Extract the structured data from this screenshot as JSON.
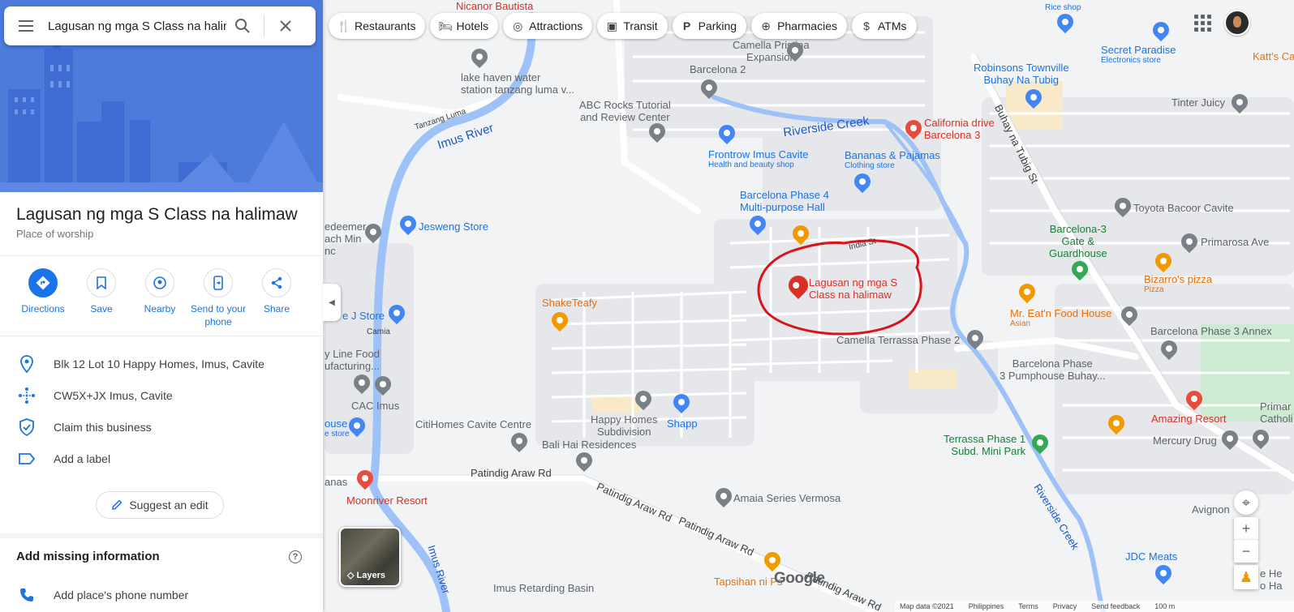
{
  "search": {
    "value": "Lagusan ng mga S Class na halimaw"
  },
  "place": {
    "title": "Lagusan ng mga S Class na halimaw",
    "category": "Place of worship"
  },
  "actions": [
    {
      "label": "Directions"
    },
    {
      "label": "Save"
    },
    {
      "label": "Nearby"
    },
    {
      "label": "Send to your phone"
    },
    {
      "label": "Share"
    }
  ],
  "info": {
    "address": "Blk 12 Lot 10 Happy Homes, Imus, Cavite",
    "plus_code": "CW5X+JX Imus, Cavite",
    "claim": "Claim this business",
    "label": "Add a label"
  },
  "suggest_edit": "Suggest an edit",
  "missing": {
    "title": "Add missing information",
    "phone": "Add place's phone number"
  },
  "chips": [
    {
      "label": "Restaurants",
      "icon": "fork-knife-icon"
    },
    {
      "label": "Hotels",
      "icon": "bed-icon"
    },
    {
      "label": "Attractions",
      "icon": "camera-icon"
    },
    {
      "label": "Transit",
      "icon": "bus-icon"
    },
    {
      "label": "Parking",
      "icon": "parking-icon"
    },
    {
      "label": "Pharmacies",
      "icon": "pharmacy-icon"
    },
    {
      "label": "ATMs",
      "icon": "atm-icon"
    }
  ],
  "map_labels": {
    "nicanor": "Nicanor Bautista",
    "rice_shop": "Rice shop",
    "lake_haven": "lake haven water",
    "lake_haven2": "station tanzang luma v...",
    "camella_pristina": "Camella Pristina",
    "expansion": "Expansion",
    "barcelona2": "Barcelona 2",
    "abc_rocks": "ABC Rocks Tutorial",
    "abc_rocks2": "and Review Center",
    "robinsons": "Robinsons Townville",
    "buhay": "Buhay Na Tubig",
    "secret_paradise": "Secret Paradise",
    "electronics": "Electronics store",
    "katts": "Katt's Ca",
    "tinter": "Tinter Juicy",
    "tanzang_luma": "Tanzang Luma",
    "imus_river": "Imus River",
    "riverside_creek": "Riverside Creek",
    "california": "California drive",
    "california2": "Barcelona 3",
    "frontrow": "Frontrow Imus Cavite",
    "frontrow_sub": "Health and beauty shop",
    "bananas": "Bananas & Pajamas",
    "bananas_sub": "Clothing store",
    "buhay_st": "Buhay na Tubig St",
    "barcelona4": "Barcelona Phase 4",
    "barcelona4b": "Multi-purpose Hall",
    "toyota": "Toyota Bacoor Cavite",
    "redeemer": "edeemer",
    "redeemer2": "ach Min",
    "redeemer3": "nc",
    "jesweng": "Jesweng Store",
    "india": "India St",
    "pin_label": "Lagusan ng mga S",
    "pin_label2": "Class na halimaw",
    "barcelona3gate": "Barcelona-3",
    "barcelona3gate2": "Gate &",
    "barcelona3gate3": "Guardhouse",
    "primarosa": "Primarosa Ave",
    "bizarros": "Bizarro's pizza",
    "bizarros_sub": "Pizza",
    "jstore": "e J Store",
    "camia": "Camia",
    "shaketeafy": "ShakeTeafy",
    "mreatn": "Mr. Eat'n Food House",
    "mreatn_sub": "Asian",
    "barcelona3annex": "Barcelona Phase 3 Annex",
    "camella_terrassa": "Camella Terrassa Phase 2",
    "lineFood": "y Line Food",
    "lineFood2": "ufacturing...",
    "barcelona_pump": "Barcelona Phase",
    "barcelona_pump2": "3 Pumphouse Buhay...",
    "cac": "CAC Imus",
    "happy_homes": "Happy Homes",
    "happy_homes2": "Subdivision",
    "shapp": "Shapp",
    "amazing": "Amazing Resort",
    "primar": "Primar",
    "catholi": "Catholi",
    "house": "ouse",
    "house_sub": "e store",
    "citihomes": "CitiHomes Cavite Centre",
    "bali_hai": "Bali Hai Residences",
    "terrassa1": "Terrassa Phase 1",
    "terrassa1b": "Subd. Mini Park",
    "mercury": "Mercury Drug",
    "anas": "anas",
    "patindig": "Patindig Araw Rd",
    "patindig2": "Patindig Araw Rd",
    "patindig3": "Patindig Araw Rd",
    "patindig4": "Patindig Araw Rd",
    "moonriver": "Moonriver Resort",
    "amaia": "Amaia Series Vermosa",
    "avignon": "Avignon",
    "jdc": "JDC Meats",
    "riverside_creek2": "Riverside Creek",
    "imus_river2": "Imus River",
    "imus_retarding": "Imus Retarding Basin",
    "tapsihan": "Tapsihan ni Ps",
    "ehe": "e He",
    "edea": "o Ha"
  },
  "layers_label": "Layers",
  "google": "Google",
  "footer": {
    "map_data": "Map data ©2021",
    "country": "Philippines",
    "terms": "Terms",
    "privacy": "Privacy",
    "feedback": "Send feedback",
    "scale": "100 m"
  },
  "colors": {
    "accent": "#1a73e8",
    "hero": "#4c7bdc",
    "circle": "#d8131b",
    "river": "#9ec1f7"
  }
}
